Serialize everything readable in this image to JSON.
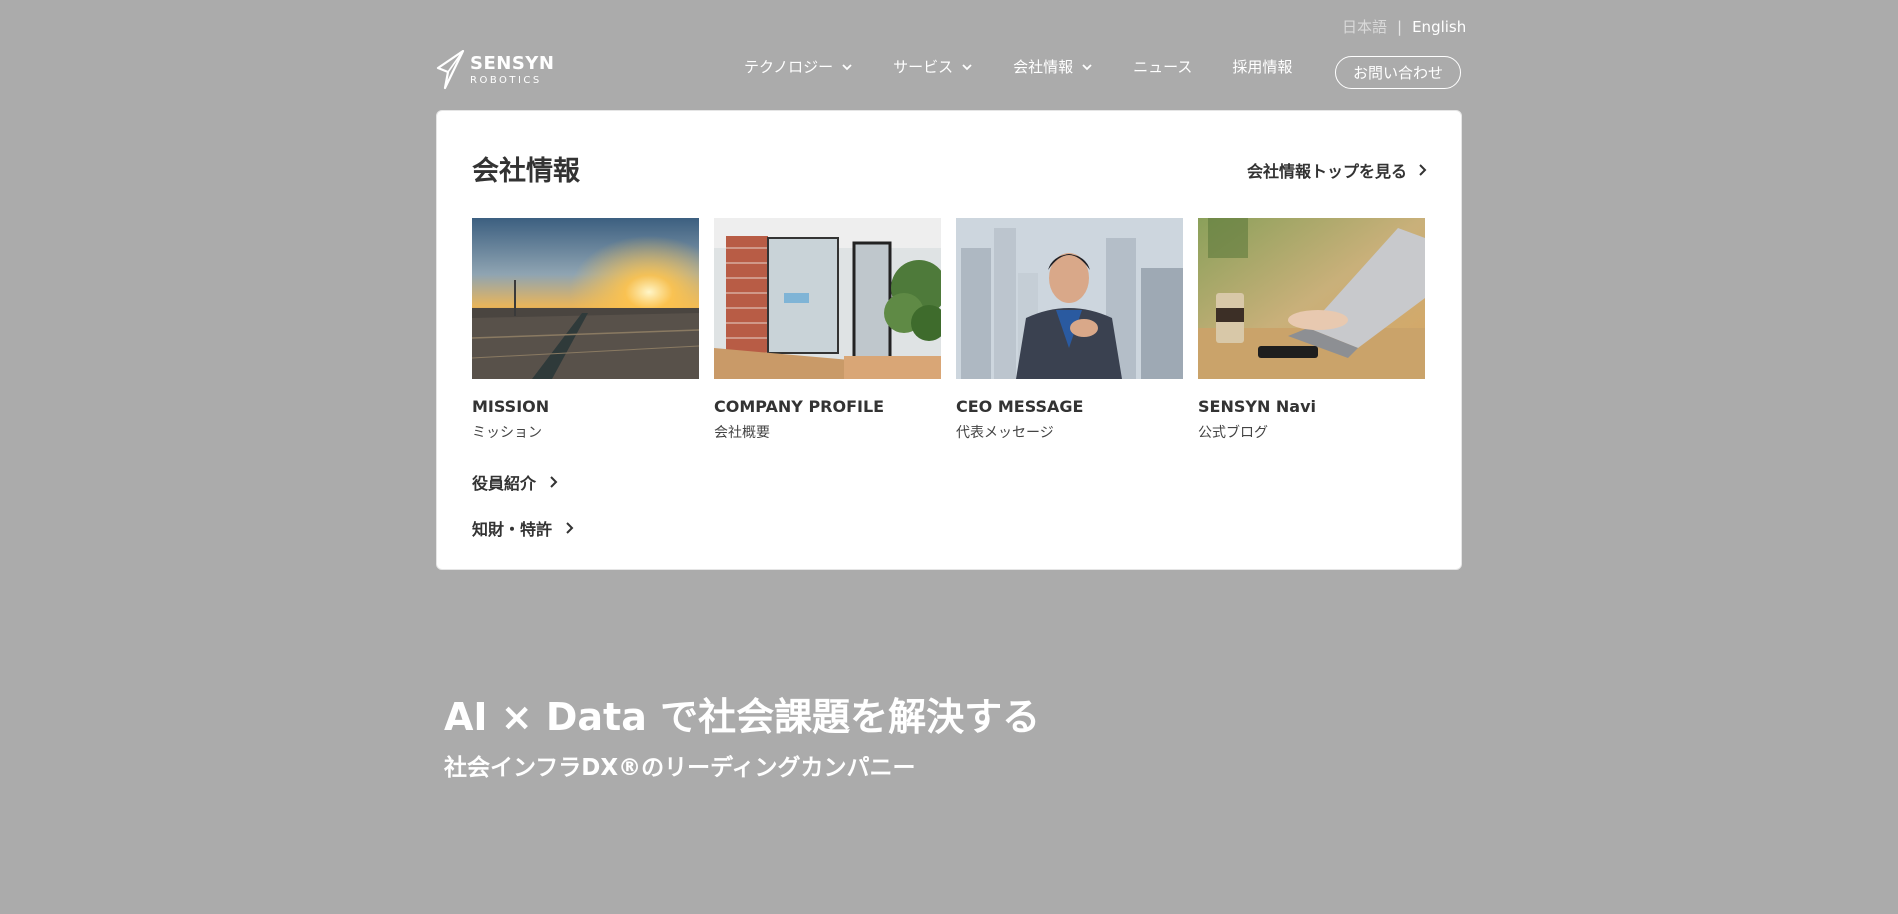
{
  "lang": {
    "ja": "日本語",
    "separator": "|",
    "en": "English"
  },
  "logo": {
    "line1": "SENSYN",
    "line2": "ROBOTICS"
  },
  "nav": {
    "items": [
      {
        "label": "テクノロジー",
        "has_dropdown": true
      },
      {
        "label": "サービス",
        "has_dropdown": true
      },
      {
        "label": "会社情報",
        "has_dropdown": true
      },
      {
        "label": "ニュース",
        "has_dropdown": false
      },
      {
        "label": "採用情報",
        "has_dropdown": false
      }
    ],
    "contact": "お問い合わせ"
  },
  "panel": {
    "title": "会社情報",
    "top_link": "会社情報トップを見る",
    "cards": [
      {
        "en": "MISSION",
        "jp": "ミッション",
        "image": "city-sunset-photo"
      },
      {
        "en": "COMPANY PROFILE",
        "jp": "会社概要",
        "image": "office-entrance-photo"
      },
      {
        "en": "CEO MESSAGE",
        "jp": "代表メッセージ",
        "image": "ceo-portrait-photo"
      },
      {
        "en": "SENSYN Navi",
        "jp": "公式ブログ",
        "image": "laptop-cafe-photo"
      }
    ],
    "links": [
      "役員紹介",
      "知財・特許"
    ]
  },
  "hero": {
    "title": "AI × Data で社会課題を解決する",
    "subtitle": "社会インフラDX®のリーディングカンパニー"
  },
  "colors": {
    "overlay_bg": "#ababab",
    "panel_bg": "#ffffff",
    "text": "#333333"
  }
}
